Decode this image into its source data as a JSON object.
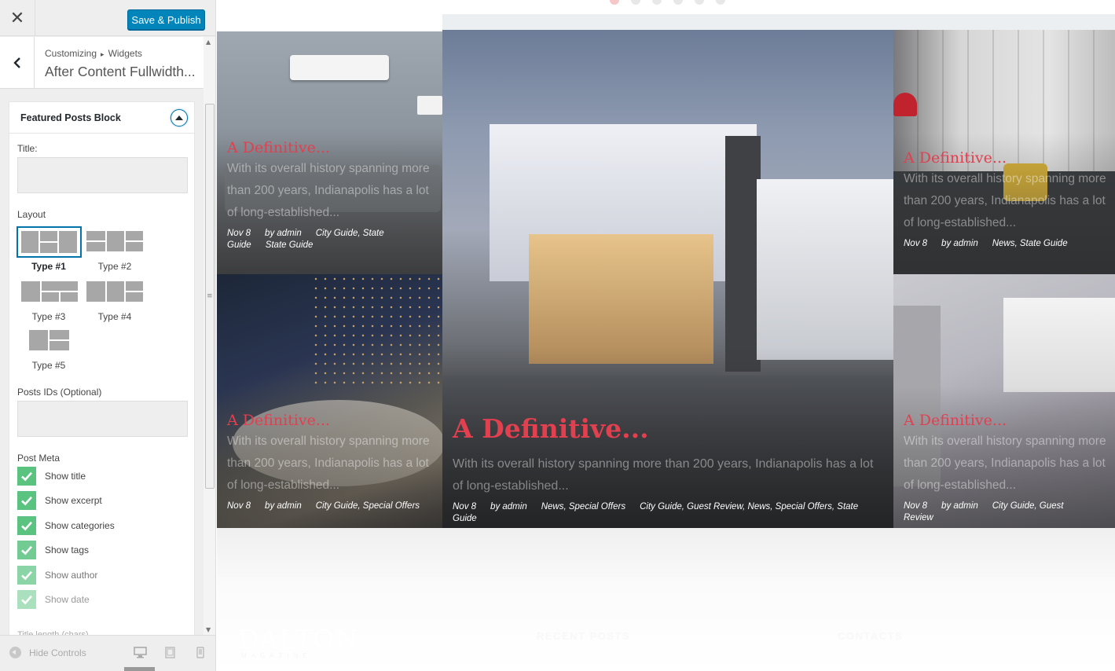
{
  "customizer": {
    "close_icon": "close-icon",
    "save_publish_label": "Save & Publish",
    "breadcrumb": {
      "root": "Customizing",
      "current": "Widgets"
    },
    "section_title": "After Content Fullwidth...",
    "widget": {
      "title": "Featured Posts Block",
      "title_label": "Title:",
      "title_value": "",
      "layout_label": "Layout",
      "layouts": [
        "Type #1",
        "Type #2",
        "Type #3",
        "Type #4",
        "Type #5"
      ],
      "selected_layout": "Type #1",
      "posts_ids_label": "Posts IDs (Optional)",
      "posts_ids_value": "",
      "post_meta_label": "Post Meta",
      "post_meta": [
        {
          "label": "Show title",
          "checked": true
        },
        {
          "label": "Show excerpt",
          "checked": true
        },
        {
          "label": "Show categories",
          "checked": true
        },
        {
          "label": "Show tags",
          "checked": true
        },
        {
          "label": "Show author",
          "checked": true
        },
        {
          "label": "Show date",
          "checked": true
        }
      ],
      "title_length_label": "Title length (chars)"
    },
    "footer": {
      "hide_controls_label": "Hide Controls",
      "devices": [
        "desktop",
        "tablet",
        "mobile"
      ],
      "active_device": "desktop"
    },
    "accent_color": "#0085ba",
    "check_color": "#59c37f"
  },
  "preview": {
    "slider_dots": 6,
    "active_dot": 1,
    "posts": [
      {
        "title": "A Definitive...",
        "excerpt": "With its overall history spanning more than 200 years, Indianapolis has a lot of long-established...",
        "date": "Nov 8",
        "author": "by admin",
        "categories": "City Guide, State Guide",
        "tags": "State Guide"
      },
      {
        "title": "A Definitive...",
        "excerpt": "With its overall history spanning more than 200 years, Indianapolis has a lot of long-established...",
        "date": "Nov 8",
        "author": "by admin",
        "categories": "City Guide, Special Offers"
      },
      {
        "title": "A Definitive...",
        "excerpt": "With its overall history spanning more than 200 years, Indianapolis has a lot of long-established...",
        "date": "Nov 8",
        "author": "by admin",
        "categories": "News, Special Offers",
        "tags": "City Guide, Guest Review, News, Special Offers, State Guide"
      },
      {
        "title": "A Definitive...",
        "excerpt": "With its overall history spanning more than 200 years, Indianapolis has a lot of long-established...",
        "date": "Nov 8",
        "author": "by admin",
        "categories": "News, State Guide"
      },
      {
        "title": "A Definitive...",
        "excerpt": "With its overall history spanning more than 200 years, Indianapolis has a lot of long-established...",
        "date": "Nov 8",
        "author": "by admin",
        "categories": "City Guide, Guest Review"
      }
    ],
    "post_title_color": "#e23f4f",
    "footer": {
      "logo": "DALTON",
      "logo_sub": "MAGAZINE",
      "recent_posts_heading": "RECENT POSTS",
      "contacts_heading": "CONTACTS"
    }
  }
}
